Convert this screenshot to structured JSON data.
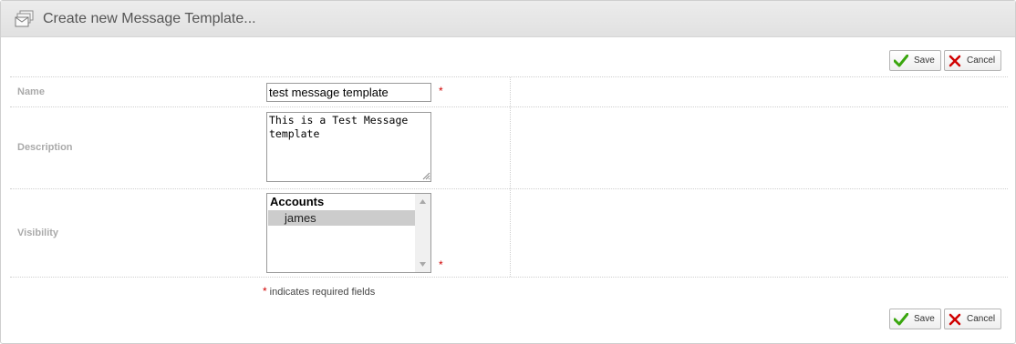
{
  "header": {
    "title": "Create new Message Template...",
    "icon": "template-icon"
  },
  "toolbar": {
    "save_label": "Save",
    "cancel_label": "Cancel",
    "save_icon": "checkmark-icon",
    "cancel_icon": "x-icon"
  },
  "form": {
    "name": {
      "label": "Name",
      "value": "test message template",
      "required_mark": "*"
    },
    "description": {
      "label": "Description",
      "value": "This is a Test Message template"
    },
    "visibility": {
      "label": "Visibility",
      "group_label": "Accounts",
      "options": [
        "james"
      ],
      "selected": "james",
      "required_mark": "*"
    }
  },
  "footnote": {
    "star": "*",
    "text": "indicates required fields"
  },
  "colors": {
    "required": "#d00000",
    "save_check": "#3aa60e",
    "cancel_x": "#d00000"
  }
}
